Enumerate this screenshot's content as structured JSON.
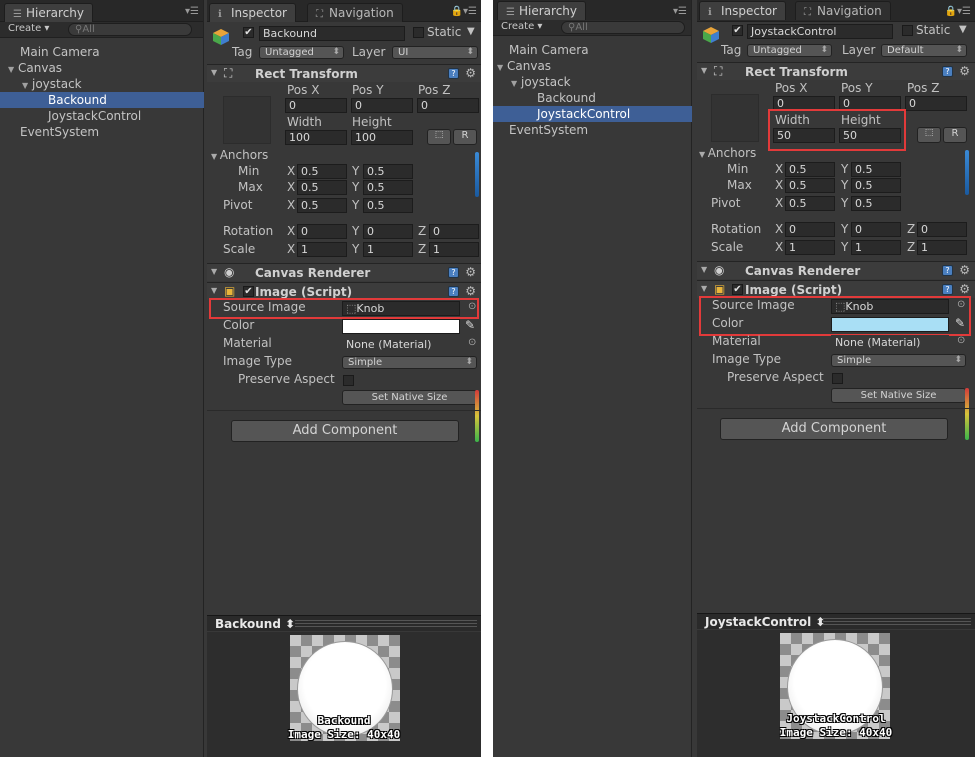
{
  "hierarchy": {
    "tab_label": "Hierarchy",
    "create_label": "Create ▾",
    "search_placeholder": "All",
    "left_items": [
      "Main Camera",
      "Canvas",
      "joystack",
      "Backound",
      "JoystackControl",
      "EventSystem"
    ],
    "right_items": [
      "Main Camera",
      "Canvas",
      "joystack",
      "Backound",
      "JoystackControl",
      "EventSystem"
    ]
  },
  "tabs": {
    "inspector": "Inspector",
    "navigation": "Navigation"
  },
  "labels": {
    "static": "Static",
    "tag": "Tag",
    "layer": "Layer",
    "rect_transform": "Rect Transform",
    "pos_x": "Pos X",
    "pos_y": "Pos Y",
    "pos_z": "Pos Z",
    "width": "Width",
    "height": "Height",
    "anchors": "Anchors",
    "min": "Min",
    "max": "Max",
    "pivot": "Pivot",
    "rotation": "Rotation",
    "scale": "Scale",
    "x": "X",
    "y": "Y",
    "z": "Z",
    "canvas_renderer": "Canvas Renderer",
    "image_script": "Image (Script)",
    "source_image": "Source Image",
    "color": "Color",
    "material": "Material",
    "image_type": "Image Type",
    "preserve_aspect": "Preserve Aspect",
    "set_native_size": "Set Native Size",
    "add_component": "Add Component",
    "r_button": "R"
  },
  "left": {
    "object_name": "Backound",
    "tag": "Untagged",
    "layer": "UI",
    "pos": [
      "0",
      "0",
      "0"
    ],
    "width": "100",
    "height": "100",
    "anchor_min": [
      "0.5",
      "0.5"
    ],
    "anchor_max": [
      "0.5",
      "0.5"
    ],
    "pivot": [
      "0.5",
      "0.5"
    ],
    "rotation": [
      "0",
      "0",
      "0"
    ],
    "scale": [
      "1",
      "1",
      "1"
    ],
    "source_image": "Knob",
    "color_hex": "#ffffff",
    "material": "None (Material)",
    "image_type": "Simple",
    "preview_name": "Backound ⬍",
    "preview_title": "Backound",
    "preview_size": "Image Size: 40x40"
  },
  "right": {
    "object_name": "JoystackControl",
    "tag": "Untagged",
    "layer": "Default",
    "pos": [
      "0",
      "0",
      "0"
    ],
    "width": "50",
    "height": "50",
    "anchor_min": [
      "0.5",
      "0.5"
    ],
    "anchor_max": [
      "0.5",
      "0.5"
    ],
    "pivot": [
      "0.5",
      "0.5"
    ],
    "rotation": [
      "0",
      "0",
      "0"
    ],
    "scale": [
      "1",
      "1",
      "1"
    ],
    "source_image": "Knob",
    "color_hex": "#a9dff5",
    "material": "None (Material)",
    "image_type": "Simple",
    "preview_name": "JoystackControl ⬍",
    "preview_title": "JoystackControl",
    "preview_size": "Image Size: 40x40"
  },
  "colors": {
    "selection": "#3e5f96",
    "highlight": "#e23a3a",
    "panel": "#383838"
  }
}
